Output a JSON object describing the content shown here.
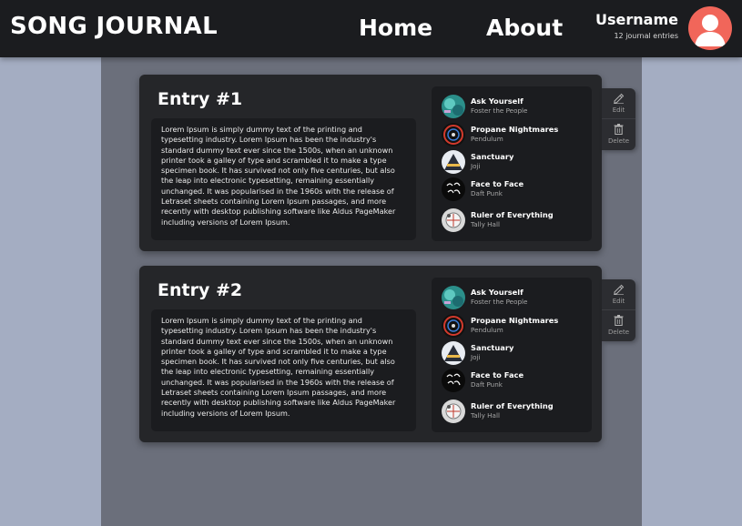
{
  "header": {
    "brand": "SONG JOURNAL",
    "nav": {
      "home": "Home",
      "about": "About"
    },
    "user": {
      "name": "Username",
      "entry_count": "12 journal entries"
    }
  },
  "colors": {
    "header_bg": "#1b1c1f",
    "page_bg": "#a4adc2",
    "column_bg": "#6b6f7b",
    "card_bg": "#252629",
    "avatar": "#f1665a"
  },
  "entries": [
    {
      "title": "Entry #1",
      "text": "Lorem Ipsum is simply dummy text of the printing and typesetting industry. Lorem Ipsum has been the industry's standard dummy text ever since the 1500s, when an unknown printer took a galley of type and scrambled it to make a type specimen book. It has survived not only five centuries, but also the leap into electronic typesetting, remaining essentially unchanged. It was popularised in the 1960s with the release of Letraset sheets containing Lorem Ipsum passages, and more recently with desktop publishing software like Aldus PageMaker including versions of Lorem Ipsum.",
      "songs": [
        {
          "title": "Ask Yourself",
          "artist": "Foster the People",
          "icon": "album-cover-ask-yourself"
        },
        {
          "title": "Propane Nightmares",
          "artist": "Pendulum",
          "icon": "album-cover-propane-nightmares"
        },
        {
          "title": "Sanctuary",
          "artist": "Joji",
          "icon": "album-cover-sanctuary"
        },
        {
          "title": "Face to Face",
          "artist": "Daft Punk",
          "icon": "album-cover-face-to-face"
        },
        {
          "title": "Ruler of Everything",
          "artist": "Tally Hall",
          "icon": "album-cover-ruler-of-everything"
        }
      ],
      "actions": {
        "edit": "Edit",
        "delete": "Delete"
      }
    },
    {
      "title": "Entry #2",
      "text": "Lorem Ipsum is simply dummy text of the printing and typesetting industry. Lorem Ipsum has been the industry's standard dummy text ever since the 1500s, when an unknown printer took a galley of type and scrambled it to make a type specimen book. It has survived not only five centuries, but also the leap into electronic typesetting, remaining essentially unchanged. It was popularised in the 1960s with the release of Letraset sheets containing Lorem Ipsum passages, and more recently with desktop publishing software like Aldus PageMaker including versions of Lorem Ipsum.",
      "songs": [
        {
          "title": "Ask Yourself",
          "artist": "Foster the People",
          "icon": "album-cover-ask-yourself"
        },
        {
          "title": "Propane Nightmares",
          "artist": "Pendulum",
          "icon": "album-cover-propane-nightmares"
        },
        {
          "title": "Sanctuary",
          "artist": "Joji",
          "icon": "album-cover-sanctuary"
        },
        {
          "title": "Face to Face",
          "artist": "Daft Punk",
          "icon": "album-cover-face-to-face"
        },
        {
          "title": "Ruler of Everything",
          "artist": "Tally Hall",
          "icon": "album-cover-ruler-of-everything"
        }
      ],
      "actions": {
        "edit": "Edit",
        "delete": "Delete"
      }
    }
  ]
}
